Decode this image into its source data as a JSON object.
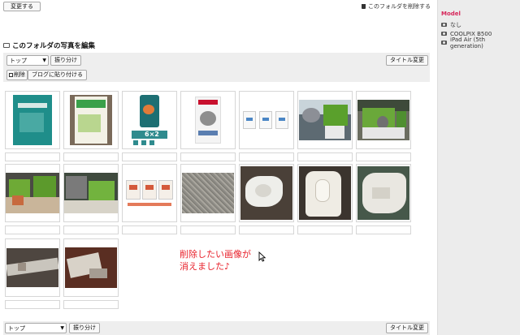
{
  "top_button": "変更する",
  "delete_folder_link": "このフォルダを削除する",
  "section_title": "このフォルダの写真を編集",
  "toolbar": {
    "select_value": "トップ",
    "sort_button": "振り分け",
    "rename_button": "タイトル変更",
    "delete_button": "削除",
    "paste_button": "ブログに貼り付ける"
  },
  "photos": [
    {
      "id": "teal-book"
    },
    {
      "id": "green-book"
    },
    {
      "id": "cat-food-teal"
    },
    {
      "id": "royal-canin"
    },
    {
      "id": "grass-packs"
    },
    {
      "id": "cat-grass-1"
    },
    {
      "id": "cat-grass-2"
    },
    {
      "id": "grass-pots-1"
    },
    {
      "id": "grass-pots-2"
    },
    {
      "id": "label-sheets"
    },
    {
      "id": "granules"
    },
    {
      "id": "cloth-roll"
    },
    {
      "id": "paper-roll"
    },
    {
      "id": "cloth-2"
    },
    {
      "id": "tool-1"
    },
    {
      "id": "tool-2"
    }
  ],
  "annotation": {
    "line1": "削除したい画像が",
    "line2": "消えました♪"
  },
  "bottom_toolbar": {
    "select_value": "トップ",
    "sort_button": "振り分け",
    "rename_button": "タイトル変更"
  },
  "sidebar": {
    "heading": "Model",
    "items": [
      "なし",
      "COOLPIX B500",
      "iPad Air (5th generation)"
    ]
  },
  "colors": {
    "annotation": "#e8212b",
    "model_heading": "#d6265a"
  }
}
